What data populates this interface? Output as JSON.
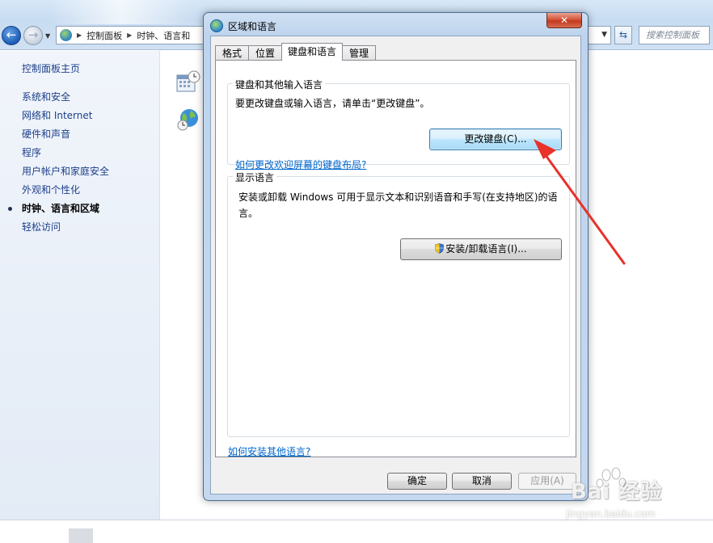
{
  "explorer": {
    "breadcrumb": [
      "控制面板",
      "时钟、语言和"
    ],
    "search_placeholder": "搜索控制面板",
    "sidebar": {
      "home": "控制面板主页",
      "items": [
        {
          "label": "系统和安全"
        },
        {
          "label": "网络和 Internet"
        },
        {
          "label": "硬件和声音"
        },
        {
          "label": "程序"
        },
        {
          "label": "用户帐户和家庭安全"
        },
        {
          "label": "外观和个性化"
        },
        {
          "label": "时钟、语言和区域",
          "current": true
        },
        {
          "label": "轻松访问"
        }
      ]
    }
  },
  "dialog": {
    "title": "区域和语言",
    "close_glyph": "✕",
    "tabs": [
      {
        "label": "格式",
        "active": false
      },
      {
        "label": "位置",
        "active": false
      },
      {
        "label": "键盘和语言",
        "active": true
      },
      {
        "label": "管理",
        "active": false
      }
    ],
    "keyboard_group": {
      "label": "键盘和其他输入语言",
      "description": "要更改键盘或输入语言，请单击“更改键盘”。",
      "button": "更改键盘(C)...",
      "link": "如何更改欢迎屏幕的键盘布局?"
    },
    "display_group": {
      "label": "显示语言",
      "description_line1": "安装或卸载 Windows 可用于显示文本和识别语音和手写(在支持地区)的语",
      "description_line2": "言。",
      "button": "安装/卸载语言(I)..."
    },
    "bottom_link": "如何安装其他语言?",
    "buttons": {
      "ok": "确定",
      "cancel": "取消",
      "apply": "应用(A)"
    }
  },
  "watermark": {
    "brand": "Bai 经验",
    "url": "jingyan.baidu.com"
  },
  "colors": {
    "annotation_arrow": "#e8322a",
    "link": "#0066cc",
    "sidebar_link": "#1d3f8a"
  }
}
